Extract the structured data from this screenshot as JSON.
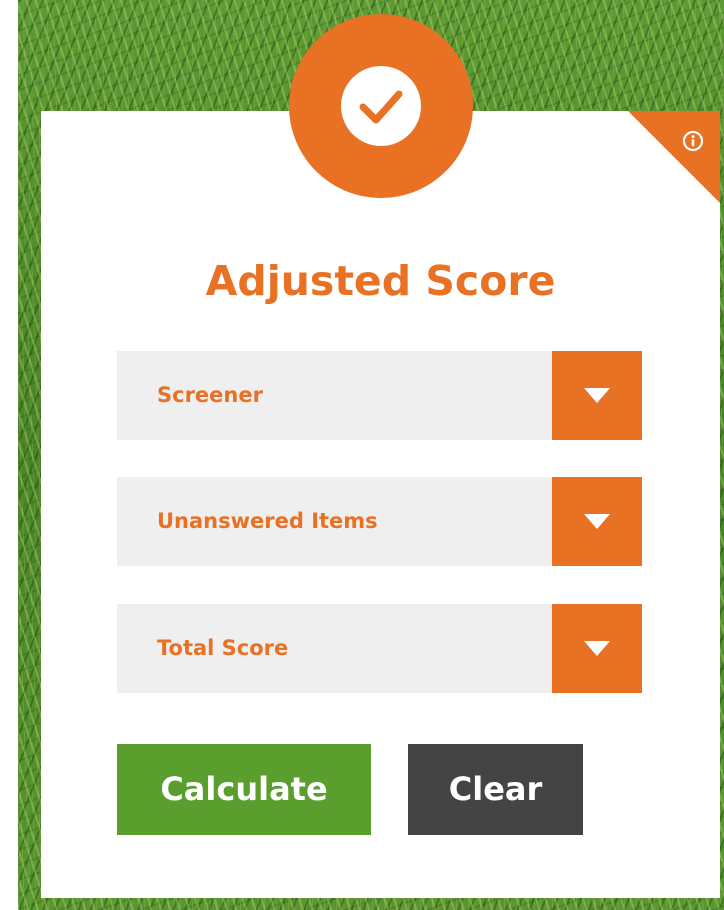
{
  "title": "Adjusted Score",
  "icons": {
    "badge": "checkmark-icon",
    "corner": "info-icon",
    "dropdown": "chevron-down-icon"
  },
  "colors": {
    "accent": "#e87124",
    "calculate": "#5a9e2e",
    "clear": "#444444",
    "field_bg": "#efefef",
    "background": "grass"
  },
  "fields": [
    {
      "label": "Screener"
    },
    {
      "label": "Unanswered Items"
    },
    {
      "label": "Total Score"
    }
  ],
  "buttons": {
    "calculate": "Calculate",
    "clear": "Clear"
  }
}
